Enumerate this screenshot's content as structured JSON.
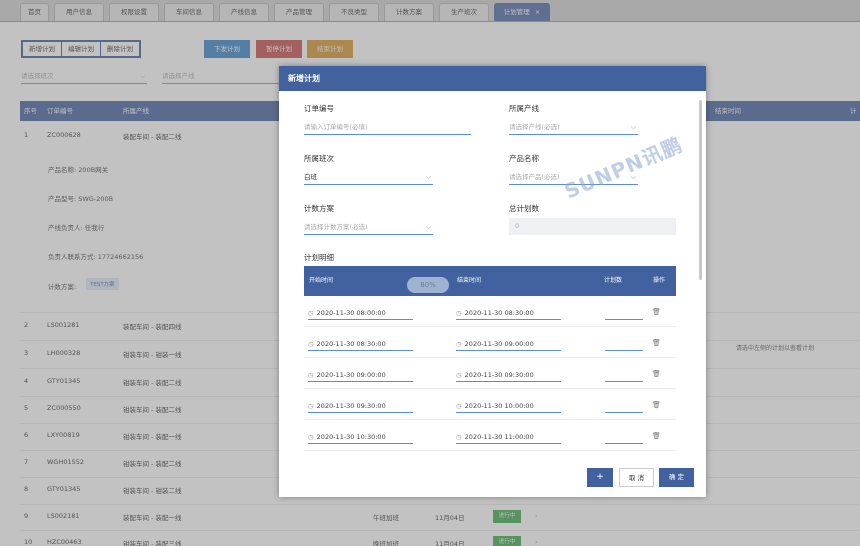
{
  "tabs": [
    {
      "label": "首页"
    },
    {
      "label": "用户信息"
    },
    {
      "label": "权限设置"
    },
    {
      "label": "车间信息"
    },
    {
      "label": "产线信息"
    },
    {
      "label": "产品管理"
    },
    {
      "label": "不良类型"
    },
    {
      "label": "计数方案"
    },
    {
      "label": "生产班次"
    },
    {
      "label": "计划管理",
      "close": "×"
    }
  ],
  "toolbar": {
    "new": "新增计划",
    "edit": "编辑计划",
    "delete": "删除计划",
    "dispatch": "下发计划",
    "pause": "暂停计划",
    "finish": "结束计划"
  },
  "filters": {
    "shift": "请选择班次",
    "line": "请选择产线"
  },
  "table": {
    "headers": {
      "no": "序号",
      "order": "订单编号",
      "line": "所属产线",
      "end_time": "结束时间",
      "plan": "计"
    },
    "rows": [
      {
        "no": "1",
        "order": "ZC000628",
        "line": "装配车间 - 装配二线"
      },
      {
        "no": "2",
        "order": "LS001281",
        "line": "装配车间 - 装配四线"
      },
      {
        "no": "3",
        "order": "LH000328",
        "line": "钳装车间 - 钳装一线"
      },
      {
        "no": "4",
        "order": "GTY01345",
        "line": "钳装车间 - 装配二线"
      },
      {
        "no": "5",
        "order": "ZC000550",
        "line": "钳装车间 - 装配二线"
      },
      {
        "no": "6",
        "order": "LXY00819",
        "line": "钳装车间 - 装配一线"
      },
      {
        "no": "7",
        "order": "WGH01552",
        "line": "钳装车间 - 装配二线"
      },
      {
        "no": "8",
        "order": "GTY01345",
        "line": "钳装车间 - 钳装二线"
      },
      {
        "no": "9",
        "order": "LS002181",
        "line": "装配车间 - 装配一线",
        "shift": "午班加班",
        "date": "11月04日",
        "status": "进行中"
      },
      {
        "no": "10",
        "order": "HZC00463",
        "line": "钳装车间 - 装配三线",
        "shift": "晚班加班",
        "date": "11月04日",
        "status": "进行中"
      }
    ],
    "detail": {
      "product_name": "产品名称:  200B网关",
      "product_model": "产品型号:  SWG-200B",
      "owner": "产线负责人:  任我行",
      "contact": "负责人联系方式:  17724662156",
      "scheme_label": "计数方案:",
      "scheme_tag": "TEST方案"
    },
    "right_note": "请选中左侧的计划以查看计划"
  },
  "modal": {
    "title": "新增计划",
    "order_label": "订单编号",
    "order_placeholder": "请输入订单编号(必填)",
    "line_label": "所属产线",
    "line_placeholder": "请选择产线(必选)",
    "shift_label": "所属班次",
    "shift_value": "白班",
    "product_label": "产品名称",
    "product_placeholder": "请选择产品(必选)",
    "scheme_label": "计数方案",
    "scheme_placeholder": "请选择计数方案(必选)",
    "total_label": "总计划数",
    "total_value": "0",
    "detail_label": "计划明细",
    "col_start": "开始时间",
    "col_end": "结束时间",
    "col_count": "计划数",
    "col_op": "操作",
    "pill": "80%",
    "rows": [
      {
        "start": "2020-11-30 08:00:00",
        "end": "2020-11-30 08:30:00"
      },
      {
        "start": "2020-11-30 08:30:00",
        "end": "2020-11-30 09:00:00"
      },
      {
        "start": "2020-11-30 09:00:00",
        "end": "2020-11-30 09:30:00"
      },
      {
        "start": "2020-11-30 09:30:00",
        "end": "2020-11-30 10:00:00"
      },
      {
        "start": "2020-11-30 10:30:00",
        "end": "2020-11-30 11:00:00"
      }
    ],
    "add_btn": "+",
    "cancel": "取 消",
    "confirm": "确 定"
  },
  "watermark": "SUNPN讯鹏",
  "colors": {
    "primary": "#42629f",
    "dispatch": "#3a83c9",
    "pause": "#c94b4b",
    "finish": "#d9952c",
    "status": "#3ba94a"
  },
  "icons": {
    "clock": "clock-icon",
    "trash": "trash-icon",
    "chevron": "chevron-down-icon",
    "close": "close-icon"
  }
}
